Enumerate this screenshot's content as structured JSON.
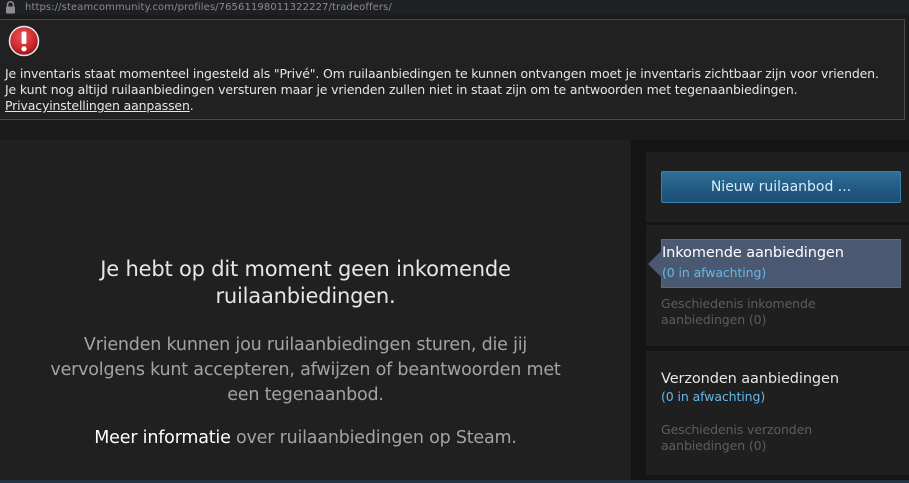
{
  "browser": {
    "url": "https://steamcommunity.com/profiles/76561198011322227/tradeoffers/"
  },
  "warning": {
    "icon": "alert-icon",
    "line1": "Je inventaris staat momenteel ingesteld als \"Privé\". Om ruilaanbiedingen te kunnen ontvangen moet je inventaris zichtbaar zijn voor vrienden.",
    "line2": "Je kunt nog altijd ruilaanbiedingen versturen maar je vrienden zullen niet in staat zijn om te antwoorden met tegenaanbiedingen.",
    "privacy_link": "Privacyinstellingen aanpassen",
    "period": "."
  },
  "main": {
    "empty_title_line1": "Je hebt op dit moment geen inkomende",
    "empty_title_line2": "ruilaanbiedingen.",
    "desc_line1": "Vrienden kunnen jou ruilaanbiedingen sturen, die jij",
    "desc_line2": "vervolgens kunt accepteren, afwijzen of beantwoorden met",
    "desc_line3": "een tegenaanbod.",
    "more_info_link": "Meer informatie",
    "more_info_rest": " over ruilaanbiedingen op Steam."
  },
  "sidebar": {
    "new_offer_label": "Nieuw ruilaanbod ...",
    "incoming": {
      "label": "Inkomende aanbiedingen",
      "pending": "(0 in afwachting)",
      "history_line1": "Geschiedenis inkomende",
      "history_line2": "aanbiedingen (0)"
    },
    "sent": {
      "label": "Verzonden aanbiedingen",
      "pending": "(0 in afwachting)",
      "history_line1": "Geschiedenis verzonden",
      "history_line2": "aanbiedingen (0)"
    }
  },
  "colors": {
    "accent_blue": "#66b8e8",
    "button_blue": "#215a82",
    "active_nav": "#4a5872",
    "alert_red": "#c8262b"
  }
}
